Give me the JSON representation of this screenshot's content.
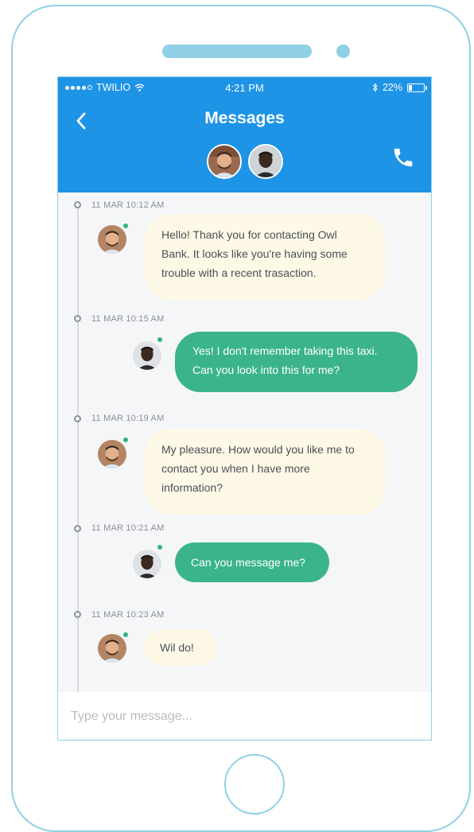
{
  "status_bar": {
    "carrier": "TWILIO",
    "time": "4:21 PM",
    "battery": "22%",
    "battery_level": 0.22
  },
  "header": {
    "title": "Messages"
  },
  "conversation": [
    {
      "time": "11 MAR 10:12 AM",
      "sender": "agent",
      "lines": [
        "Hello! Thank you for contacting Owl",
        "Bank. It looks like you're having some",
        "trouble with a recent trasaction."
      ]
    },
    {
      "time": "11 MAR 10:15 AM",
      "sender": "customer",
      "lines": [
        "Yes! I don't remember taking this taxi.",
        "Can you look into this for me?"
      ]
    },
    {
      "time": "11 MAR 10:19 AM",
      "sender": "agent",
      "lines": [
        "My pleasure. How would you like me to",
        "contact you when I have more",
        "information?"
      ]
    },
    {
      "time": "11 MAR 10:21 AM",
      "sender": "customer",
      "lines": [
        "Can you message me?"
      ]
    },
    {
      "time": "11 MAR 10:23 AM",
      "sender": "agent",
      "lines": [
        "Wil do!"
      ]
    }
  ],
  "composer": {
    "placeholder": "Type your message..."
  },
  "colors": {
    "header": "#1e94e6",
    "outgoing_bubble": "#3bb48a",
    "incoming_bubble": "#fdf9e6",
    "phone_frame": "#8fd0e6",
    "online": "#2fb582"
  }
}
